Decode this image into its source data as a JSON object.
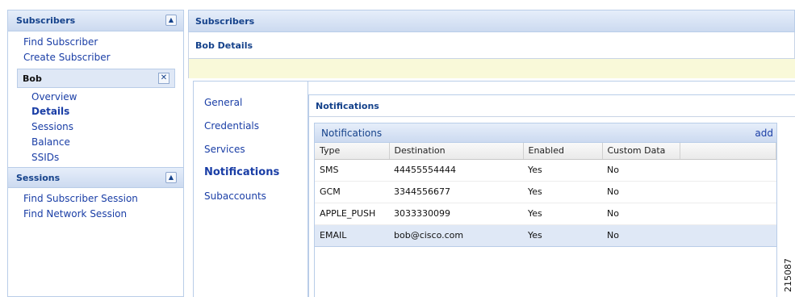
{
  "sidebar": {
    "subscribers_title": "Subscribers",
    "find_subscriber": "Find Subscriber",
    "create_subscriber": "Create Subscriber",
    "subscriber_panel": {
      "name": "Bob",
      "items": [
        "Overview",
        "Details",
        "Sessions",
        "Balance",
        "SSIDs"
      ],
      "active": "Details"
    },
    "sessions_title": "Sessions",
    "find_subscriber_session": "Find Subscriber Session",
    "find_network_session": "Find Network Session"
  },
  "main": {
    "header_title": "Subscribers",
    "details_title": "Bob Details",
    "tabs": [
      {
        "label": "General"
      },
      {
        "label": "Credentials"
      },
      {
        "label": "Services"
      },
      {
        "label": "Notifications"
      },
      {
        "label": "Subaccounts"
      }
    ],
    "active_tab": "Notifications",
    "panel_title": "Notifications",
    "grid": {
      "title": "Notifications",
      "add_label": "add",
      "columns": [
        "Type",
        "Destination",
        "Enabled",
        "Custom Data"
      ],
      "rows": [
        [
          "SMS",
          "44455554444",
          "Yes",
          "No"
        ],
        [
          "GCM",
          "3344556677",
          "Yes",
          "No"
        ],
        [
          "APPLE_PUSH",
          "3033330099",
          "Yes",
          "No"
        ],
        [
          "EMAIL",
          "bob@cisco.com",
          "Yes",
          "No"
        ]
      ],
      "selected_row": 3
    }
  },
  "figure_id": "215087",
  "colors": {
    "link": "#1a3ea6",
    "header_text": "#15428b",
    "header_bg": "#ccdaf0",
    "selected_row": "#dfe8f6",
    "info_bar": "#f9f9d9"
  }
}
